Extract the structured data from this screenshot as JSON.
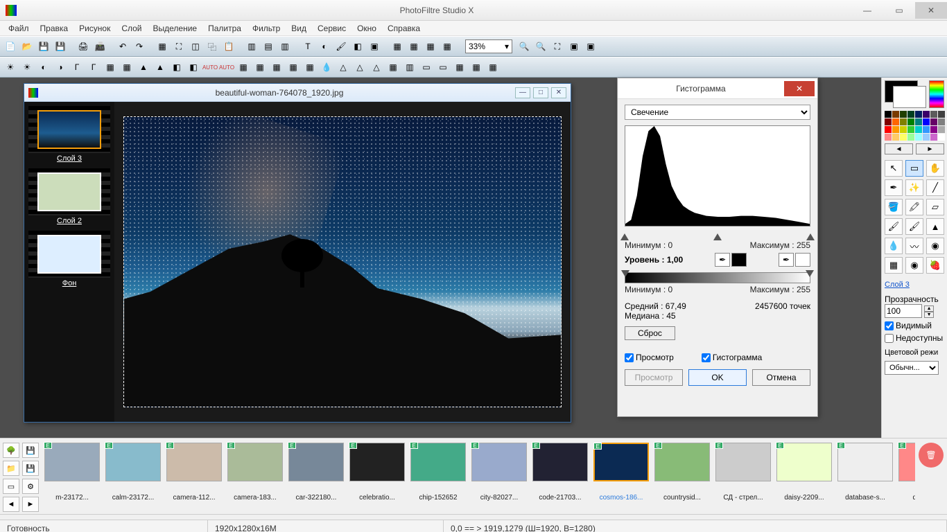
{
  "app": {
    "title": "PhotoFiltre Studio X"
  },
  "menu": [
    "Файл",
    "Правка",
    "Рисунок",
    "Слой",
    "Выделение",
    "Палитра",
    "Фильтр",
    "Вид",
    "Сервис",
    "Окно",
    "Справка"
  ],
  "zoom": "33%",
  "document": {
    "filename": "beautiful-woman-764078_1920.jpg",
    "layers": [
      {
        "name": "Слой 3",
        "selected": true
      },
      {
        "name": "Слой 2",
        "selected": false
      },
      {
        "name": "Фон",
        "selected": false
      }
    ]
  },
  "histogram": {
    "title": "Гистограмма",
    "channel": "Свечение",
    "min_label": "Минимум : 0",
    "max_label": "Максимум : 255",
    "level_label": "Уровень : 1,00",
    "out_min_label": "Минимум : 0",
    "out_max_label": "Максимум : 255",
    "mean_label": "Средний : 67,49",
    "median_label": "Медиана : 45",
    "points_label": "2457600 точек",
    "reset": "Сброс",
    "preview_chk": "Просмотр",
    "hist_chk": "Гистограмма",
    "preview_btn": "Просмотр",
    "ok": "OK",
    "cancel": "Отмена"
  },
  "chart_data": {
    "type": "area",
    "title": "Гистограмма (Свечение)",
    "xlabel": "",
    "ylabel": "",
    "xlim": [
      0,
      255
    ],
    "ylim": [
      0,
      1
    ],
    "x": [
      0,
      8,
      16,
      24,
      32,
      40,
      48,
      56,
      64,
      72,
      80,
      88,
      96,
      112,
      128,
      144,
      160,
      176,
      192,
      208,
      224,
      240,
      255
    ],
    "y": [
      0.02,
      0.06,
      0.3,
      0.7,
      0.95,
      1.0,
      0.9,
      0.62,
      0.4,
      0.28,
      0.2,
      0.16,
      0.13,
      0.1,
      0.09,
      0.09,
      0.1,
      0.1,
      0.09,
      0.08,
      0.06,
      0.04,
      0.02
    ]
  },
  "right_panel": {
    "layer_link": "Слой 3",
    "opacity_label": "Прозрачность",
    "opacity_value": "100",
    "visible": "Видимый",
    "locked": "Недоступны",
    "blend_label": "Цветовой режи",
    "blend_value": "Обычн..."
  },
  "filmstrip": [
    {
      "name": "m-23172..."
    },
    {
      "name": "calm-23172..."
    },
    {
      "name": "camera-112..."
    },
    {
      "name": "camera-183..."
    },
    {
      "name": "car-322180..."
    },
    {
      "name": "celebratio..."
    },
    {
      "name": "chip-152652"
    },
    {
      "name": "city-82027..."
    },
    {
      "name": "code-21703..."
    },
    {
      "name": "cosmos-186...",
      "selected": true,
      "link": true
    },
    {
      "name": "countrysid..."
    },
    {
      "name": "СД - стрел..."
    },
    {
      "name": "daisy-2209..."
    },
    {
      "name": "database-s..."
    },
    {
      "name": "delete-..."
    }
  ],
  "status": {
    "ready": "Готовность",
    "dims": "1920x1280x16M",
    "coords": "0,0 == > 1919,1279 (Ш=1920, В=1280)"
  },
  "palette_colors": [
    "#000",
    "#7a3b00",
    "#204000",
    "#004020",
    "#002060",
    "#3a006a",
    "#5c5c5c",
    "#404040",
    "#800000",
    "#f60",
    "#808000",
    "#008000",
    "#008080",
    "#00f",
    "#606",
    "#808080",
    "#f00",
    "#f90",
    "#cfcf00",
    "#3c3",
    "#0cc",
    "#39f",
    "#808",
    "#aaa",
    "#f88",
    "#fc6",
    "#ff6",
    "#9f9",
    "#9ff",
    "#9cf",
    "#c6c",
    "#fff"
  ]
}
